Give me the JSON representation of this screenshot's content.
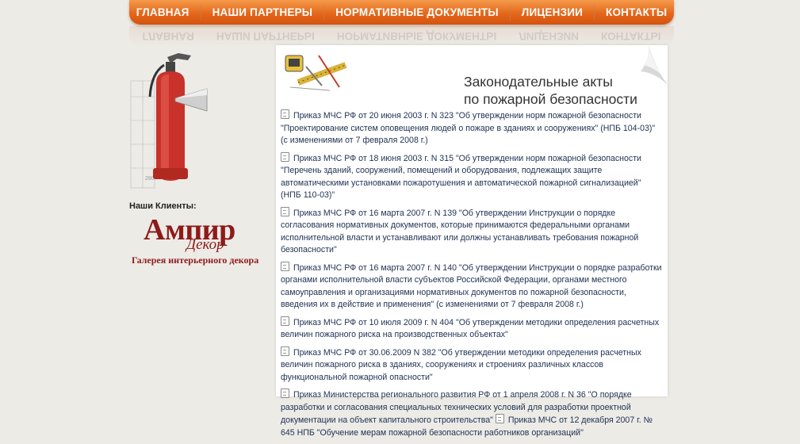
{
  "nav": {
    "items": [
      {
        "label": "ГЛАВНАЯ"
      },
      {
        "label": "НАШИ ПАРТНЕРЫ"
      },
      {
        "label": "НОРМАТИВНЫЕ ДОКУМЕНТЫ"
      },
      {
        "label": "ЛИЦЕНЗИИ"
      },
      {
        "label": "КОНТАКТЫ"
      }
    ]
  },
  "sidebar": {
    "clients_label": "Наши Клиенты:",
    "logo": {
      "main": "Ампир",
      "sub": "Декор",
      "tagline": "Галерея интерьерного декора"
    }
  },
  "content": {
    "title_line1": "Законодательные акты",
    "title_line2": "по пожарной безопасности",
    "documents": [
      "Приказ МЧС РФ от 20 июня 2003 г. N 323 \"Об утверждении норм пожарной безопасности \"Проектирование систем оповещения людей о пожаре в зданиях и сооружениях\" (НПБ 104-03)\" (с изменениями от 7 февраля 2008 г.)",
      "Приказ МЧС РФ от 18 июня 2003 г. N 315 \"Об утверждении норм пожарной безопасности \"Перечень зданий, сооружений, помещений и оборудования, подлежащих защите автоматическими установками пожаротушения и автоматической пожарной сигнализацией\" (НПБ 110-03)\"",
      "Приказ МЧС РФ от 16 марта 2007 г. N 139 \"Об утверждении Инструкции о порядке согласования нормативных документов, которые принимаются федеральными органами исполнительной власти и устанавливают или должны устанавливать требования пожарной безопасности\"",
      "Приказ МЧС РФ от 16 марта 2007 г. N 140 \"Об утверждении Инструкции о порядке разработки органами исполнительной власти субъектов Российской Федерации, органами местного самоуправления и организациями нормативных документов по пожарной безопасности, введения их в действие и применения\" (с изменениями от 7 февраля 2008 г.)",
      "Приказ МЧС РФ от 10 июля 2009 г. N 404 \"Об утверждении методики определения расчетных величин пожарного риска на производственных объектах\"",
      "Приказ МЧС РФ от 30.06.2009 N 382 \"Об утверждении методики определения расчетных величин пожарного риска в зданиях, сооружениях и строениях различных классов функциональной пожарной опасности\""
    ],
    "doc7_part1": "Приказ Министерства регионального развития РФ от 1 апреля 2008 г. N 36 \"О порядке разработки и согласования специальных технических условий для разработки проектной документации на объект капитального строительства\"",
    "doc7_part2": "Приказ МЧС от 12 декабря 2007 г. № 645 НПБ \"Обучение мерам пожарной безопасности работников организаций\""
  }
}
